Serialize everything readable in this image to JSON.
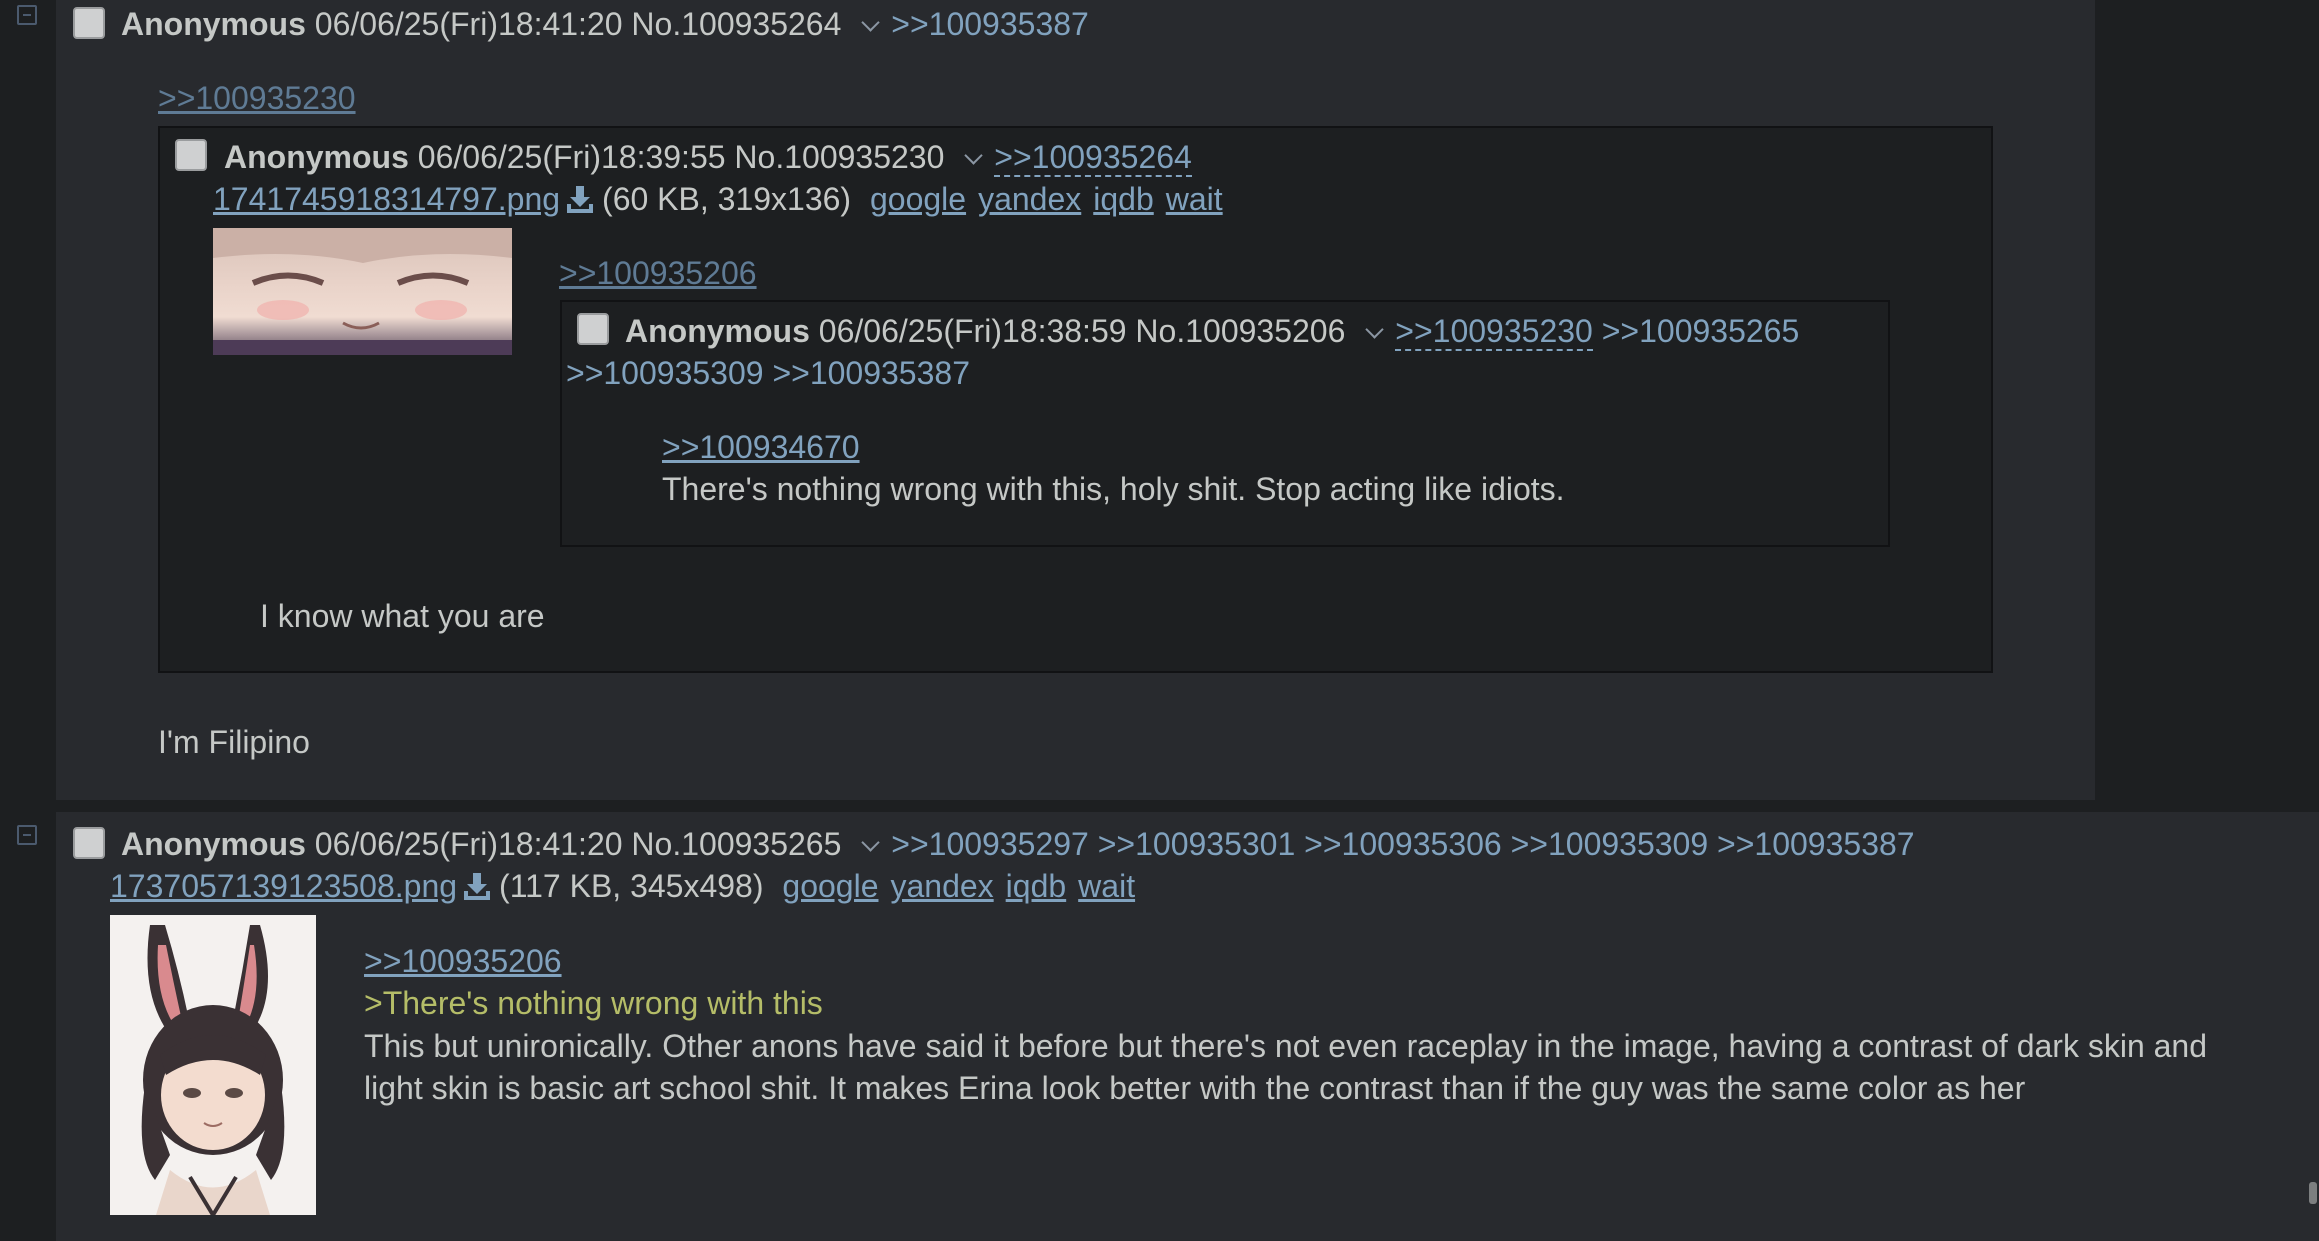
{
  "post1": {
    "name": "Anonymous",
    "datetime": "06/06/25(Fri)18:41:20",
    "number": "No.100935264",
    "backlinks": [
      ">>100935387"
    ],
    "inline_quotelink": ">>100935230",
    "comment": "I'm Filipino",
    "inline_post": {
      "name": "Anonymous",
      "datetime": "06/06/25(Fri)18:39:55",
      "number": "No.100935230",
      "backlink": ">>100935264",
      "file": {
        "filename": "1741745918314797.png",
        "info": "(60 KB, 319x136)",
        "services": [
          "google",
          "yandex",
          "iqdb",
          "wait"
        ]
      },
      "inline_quotelink": ">>100935206",
      "comment": "I know what you are",
      "inline_post": {
        "name": "Anonymous",
        "datetime": "06/06/25(Fri)18:38:59",
        "number": "No.100935206",
        "backlink_highlighted": ">>100935230",
        "backlinks": [
          ">>100935265",
          ">>100935309",
          ">>100935387"
        ],
        "quotelink": ">>100934670",
        "comment": "There's nothing wrong with this, holy shit. Stop acting like idiots."
      }
    }
  },
  "post2": {
    "name": "Anonymous",
    "datetime": "06/06/25(Fri)18:41:20",
    "number": "No.100935265",
    "backlinks": [
      ">>100935297",
      ">>100935301",
      ">>100935306",
      ">>100935309",
      ">>100935387"
    ],
    "file": {
      "filename": "1737057139123508.png",
      "info": "(117 KB, 345x498)",
      "services": [
        "google",
        "yandex",
        "iqdb",
        "wait"
      ]
    },
    "quotelink": ">>100935206",
    "greentext": ">There's nothing wrong with this",
    "comment_line1": "This but unironically. Other anons have said it before but there's not even raceplay in the image, having a contrast of dark skin and",
    "comment_line2": "light skin is basic art school shit. It makes Erina look better with the contrast than if the guy was the same color as her"
  },
  "icons": {
    "collapse": "minus-square-icon",
    "dropdown": "chevron-down-icon",
    "download": "download-icon"
  },
  "colors": {
    "background": "#1d1f21",
    "post_background": "#282a2e",
    "link": "#81a2be",
    "greentext": "#b5bd68",
    "text": "#c5c8c6"
  }
}
